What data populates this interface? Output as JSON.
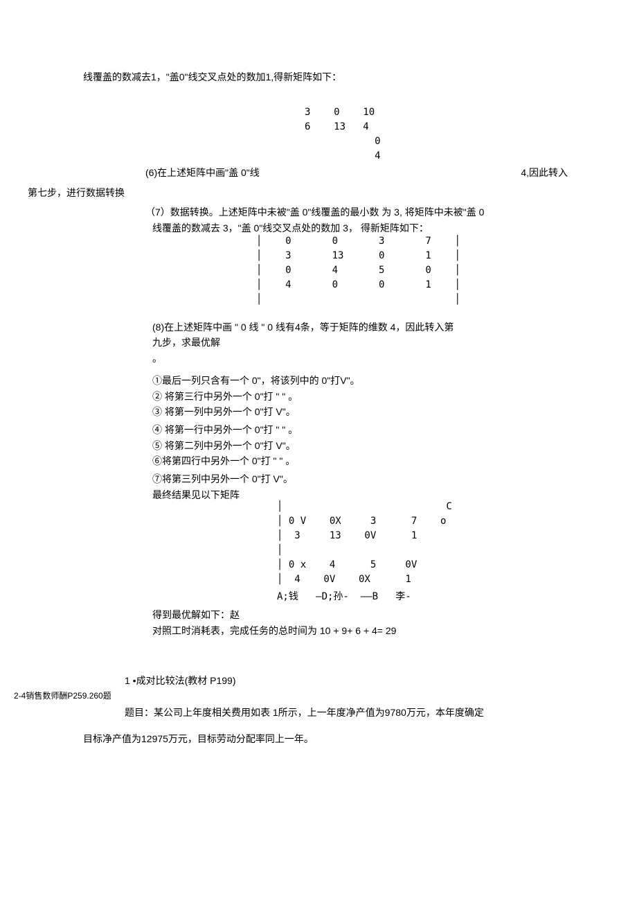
{
  "p1": "线覆盖的数减去1，\"盖0\"线交叉点处的数加1,得新矩阵如下：",
  "matrix1": "3    0    10\n6    13   4\n            0\n            4",
  "step6_left": "(6)在上述矩阵中画\"盖     0\"线",
  "step6_right": "4,因此转入",
  "step7_prefix": "第七步，进行数据转换",
  "p7a": "（7）数据转换。上述矩阵中未被\"盖     0\"线覆盖的最小数     为 3, 将矩阵中未被\"盖    0",
  "p7b": "线覆盖的数减去    3，\"盖 0\"线交叉点处的数加     3， 得新矩阵如下：",
  "matrix2": "│    0       0       3       7    │\n│    3       13      0       1    │\n│    0       4       5       0    │\n│    4       0       0       1    │\n│                                 │",
  "p8a": "(8)在上述矩阵中画      \"    0   线   \"   0   线有4条，等于矩阵的维数  4，因此转入第",
  "p8b": "九步，求最优解",
  "p8c": "。",
  "s1": "①最后一列只含有一个       0\"，将该列中的 0\"打V\"。",
  "s2": "② 将第三行中另外一个      0\"打 \"  \" 。",
  "s3": "③ 将第一列中另外一个      0\"打  V\"。",
  "s4": "④ 将第一行中另外一个      0\"打 \"  \" 。",
  "s5": "⑤ 将第二列中另外一个      0\"打  V\"。",
  "s6": "⑥将第四行中另外一个       0\"打 \"  \" 。",
  "s7": "⑦将第三列中另外一个       0\"打  V\"。",
  "s8": "最终结果见以下矩阵",
  "matrix3": "│                            C\n│ 0 V    0X     3      7    o\n│  3     13    0V      1\n│\n│ 0 x    4      5     0V\n│  4    0V    0X      1",
  "assoc": "A;钱   —D;孙-  ——B   李-",
  "res1": "得到最优解如下：赵",
  "res2": "对照工时消耗表，完成任务的总时间为     10 + 9+ 6 + 4=  29",
  "pair": "1 •成对比较法(教材      P199)",
  "footnote": "2-4销售数师酬P259.260题",
  "q1": "题目：某公司上年度相关费用如表      1所示，上一年度净产值为9780万元，本年度确定",
  "q2": "目标净产值为12975万元，目标劳动分配率同上一年。"
}
